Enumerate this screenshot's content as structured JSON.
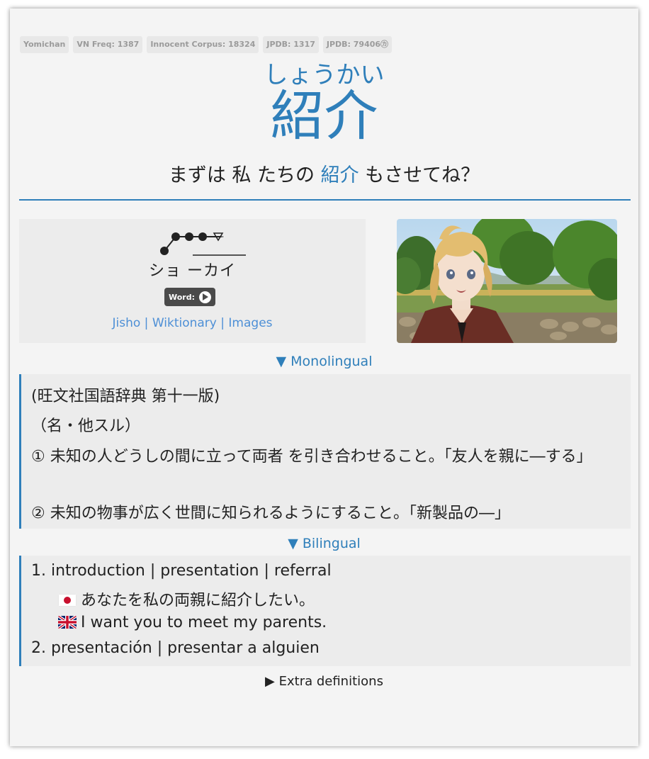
{
  "tags": [
    "Yomichan",
    "VN Freq: 1387",
    "Innocent Corpus: 18324",
    "JPDB: 1317",
    "JPDB: 79406㋕"
  ],
  "reading": "しょうかい",
  "word": "紹介",
  "sentence": {
    "before": "まずは 私 たちの ",
    "highlight": "紹介",
    "after": " もさせてね？"
  },
  "pitch": {
    "kana": "ショ ーカイ",
    "pattern": "heiban"
  },
  "audio": {
    "label": "Word:",
    "icon": "play-icon"
  },
  "links": [
    "Jisho",
    "Wiktionary",
    "Images"
  ],
  "link_separator": "|",
  "monolingual": {
    "toggle": "▼ Monolingual",
    "lines": [
      "(旺文社国語辞典 第十一版)",
      "（名・他スル）",
      "① 未知の人どうしの間に立って両者 を引き合わせること。「友人を親に―する」",
      "② 未知の物事が広く世間に知られるようにすること。「新製品の―」"
    ]
  },
  "bilingual": {
    "toggle": "▼ Bilingual",
    "def1": "1. introduction | presentation | referral",
    "example_jp": "あなたを私の両親に紹介したい。",
    "example_en": "I want you to meet my parents.",
    "def2": "2. presentación | presentar a alguien"
  },
  "extra": "▶ Extra definitions",
  "colors": {
    "accent": "#2f7fba",
    "link": "#4d8fd6",
    "card": "#f4f4f4",
    "box": "#ececec"
  }
}
